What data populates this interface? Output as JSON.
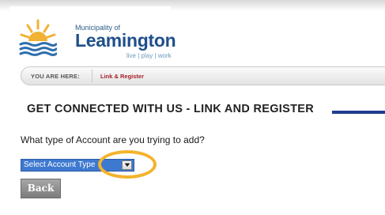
{
  "header": {
    "municipality": "Municipality of",
    "brand": "Leamington",
    "tagline": "live | play | work",
    "logo_icon": "sun-over-waves-icon"
  },
  "breadcrumb": {
    "label": "YOU ARE HERE:",
    "current": "Link & Register"
  },
  "main": {
    "heading": "GET CONNECTED WITH US - LINK AND REGISTER",
    "question": "What type of Account are you trying to add?",
    "account_select": {
      "value": "Select Account Type",
      "arrow_icon": "chevron-down-icon"
    },
    "back_label": "Back"
  },
  "colors": {
    "brand_blue": "#1f4f8b",
    "breadcrumb_link": "#a4242c",
    "select_bg": "#3e79d0",
    "highlight_ring": "#f3b32b",
    "heading_rule": "#1e3d8f"
  }
}
